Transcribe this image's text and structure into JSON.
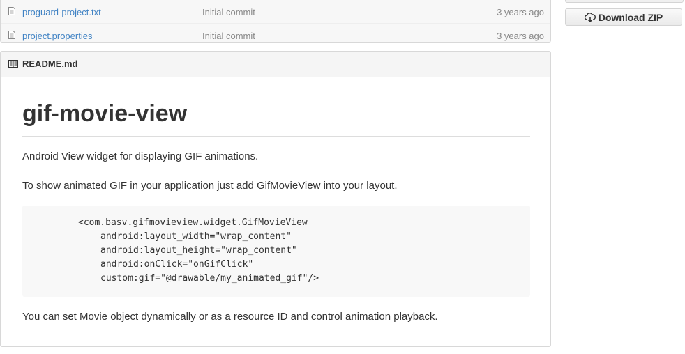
{
  "files": [
    {
      "name": "proguard-project.txt",
      "message": "Initial commit",
      "age": "3 years ago",
      "icon": "file-text-icon"
    },
    {
      "name": "project.properties",
      "message": "Initial commit",
      "age": "3 years ago",
      "icon": "file-text-icon"
    }
  ],
  "sidebar": {
    "download_zip_label": "Download ZIP",
    "download_icon": "cloud-download-icon"
  },
  "readme": {
    "header_title": "README.md",
    "header_icon": "book-icon",
    "title": "gif-movie-view",
    "paragraph1": "Android View widget for displaying GIF animations.",
    "paragraph2": "To show animated GIF in your application just add GifMovieView into your layout.",
    "code_lines": [
      "<com.basv.gifmovieview.widget.GifMovieView",
      "android:layout_width=\"wrap_content\"",
      "android:layout_height=\"wrap_content\"",
      "android:onClick=\"onGifClick\"",
      "custom:gif=\"@drawable/my_animated_gif\"/>"
    ],
    "paragraph3": "You can set Movie object dynamically or as a resource ID and control animation playback."
  },
  "colors": {
    "link": "#4183c4",
    "muted": "#888888",
    "text": "#333333"
  }
}
